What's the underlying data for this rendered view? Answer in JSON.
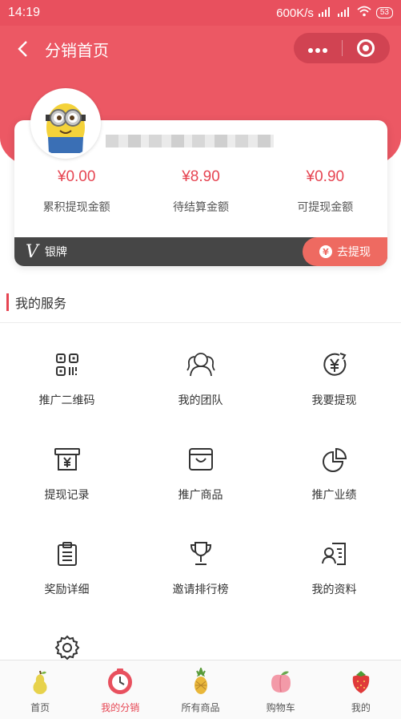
{
  "status_bar": {
    "time": "14:19",
    "network_speed": "600K/s",
    "battery": "53"
  },
  "nav": {
    "title": "分销首页",
    "back_icon": "chevron-left-icon",
    "more_icon": "more-dots-icon",
    "close_icon": "target-circle-icon"
  },
  "profile": {
    "avatar_icon": "minion-avatar"
  },
  "stats": [
    {
      "value": "¥0.00",
      "label": "累积提现金额"
    },
    {
      "value": "¥8.90",
      "label": "待结算金额"
    },
    {
      "value": "¥0.90",
      "label": "可提现金额"
    }
  ],
  "level": {
    "badge": "V",
    "name": "银牌",
    "withdraw_label": "去提现"
  },
  "services": {
    "title": "我的服务",
    "items": [
      {
        "label": "推广二维码",
        "icon": "qrcode-icon"
      },
      {
        "label": "我的团队",
        "icon": "team-icon"
      },
      {
        "label": "我要提现",
        "icon": "withdraw-yen-icon"
      },
      {
        "label": "提现记录",
        "icon": "withdraw-record-icon"
      },
      {
        "label": "推广商品",
        "icon": "shopping-bag-icon"
      },
      {
        "label": "推广业绩",
        "icon": "pie-chart-icon"
      },
      {
        "label": "奖励详细",
        "icon": "clipboard-icon"
      },
      {
        "label": "邀请排行榜",
        "icon": "trophy-icon"
      },
      {
        "label": "我的资料",
        "icon": "id-card-icon"
      },
      {
        "label": "",
        "icon": "settings-badge-icon"
      }
    ]
  },
  "tabbar": [
    {
      "label": "首页",
      "icon": "pear-icon",
      "active": false
    },
    {
      "label": "我的分销",
      "icon": "clock-icon",
      "active": true
    },
    {
      "label": "所有商品",
      "icon": "pineapple-icon",
      "active": false
    },
    {
      "label": "购物车",
      "icon": "peach-icon",
      "active": false
    },
    {
      "label": "我的",
      "icon": "strawberry-icon",
      "active": false
    }
  ],
  "colors": {
    "brand": "#ec5864",
    "accent": "#e64552",
    "level_bar": "#464646",
    "withdraw_button": "#ee6a61"
  }
}
